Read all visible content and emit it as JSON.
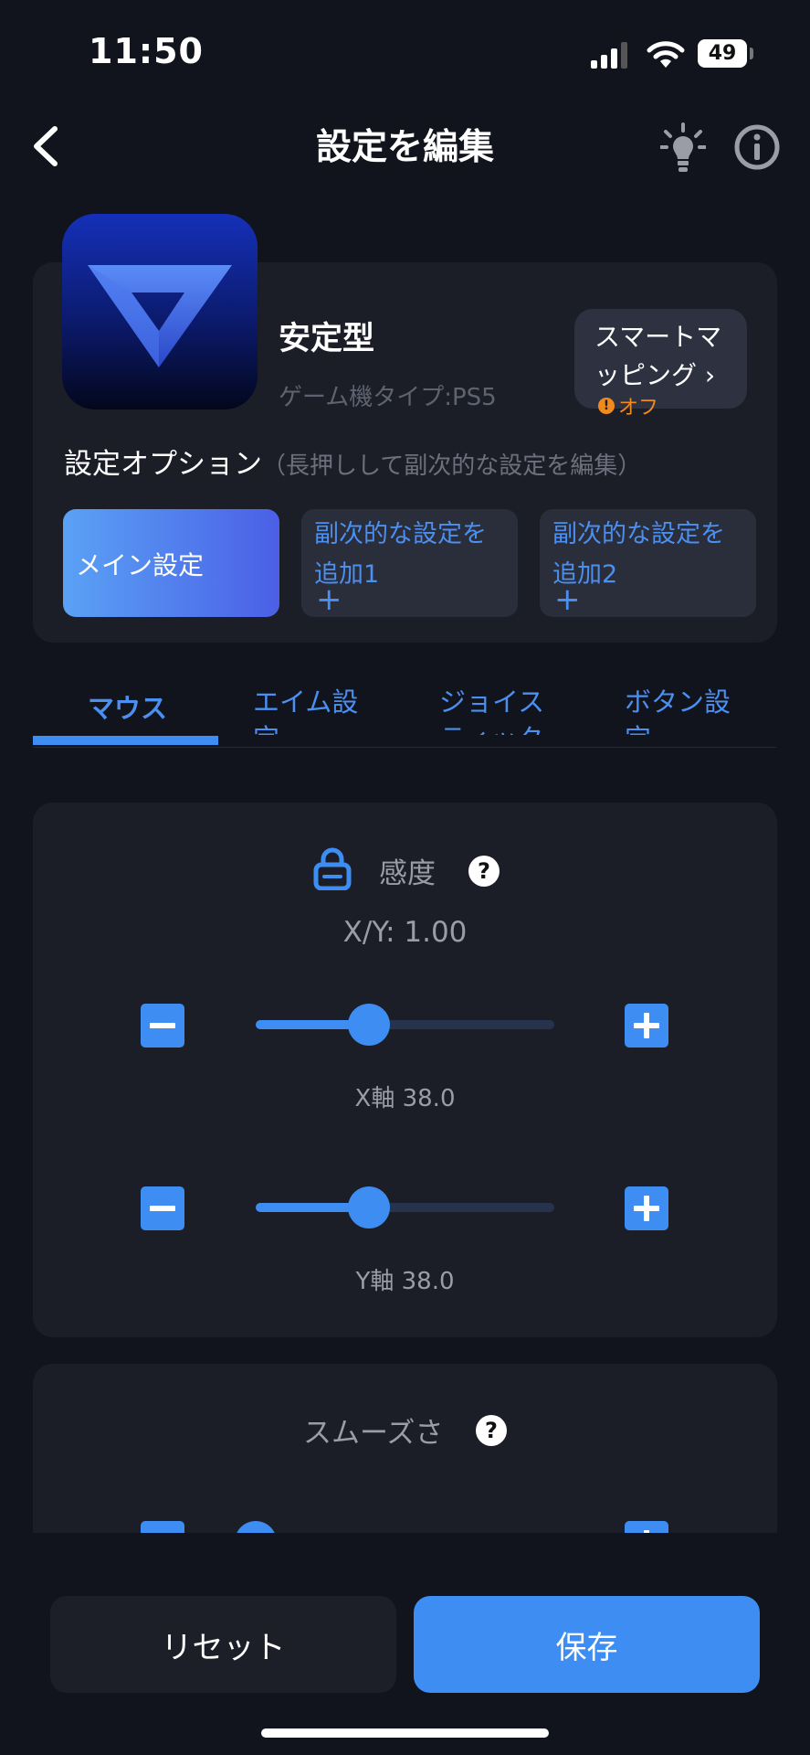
{
  "status_bar": {
    "time": "11:50",
    "battery": "49"
  },
  "header": {
    "title": "設定を編集"
  },
  "profile": {
    "name": "安定型",
    "console_type": "ゲーム機タイプ:PS5",
    "smart_mapping": {
      "label": "スマートマッピング ›",
      "status": "オフ",
      "status_icon": "!"
    }
  },
  "options": {
    "title": "設定オプション",
    "hint": "（長押しして副次的な設定を編集）",
    "main": "メイン設定",
    "sub1": "副次的な設定を追加1",
    "sub2": "副次的な設定を追加2",
    "add_symbol": "+"
  },
  "tabs": [
    {
      "label": "マウス",
      "active": true
    },
    {
      "label": "エイム設定"
    },
    {
      "label": "ジョイスティック"
    },
    {
      "label": "ボタン設定"
    }
  ],
  "sensitivity": {
    "title": "感度",
    "help": "?",
    "xy_label": "X/Y:  1.00",
    "x_axis": {
      "label": "X軸  38.0",
      "fraction": 0.38
    },
    "y_axis": {
      "label": "Y軸  38.0",
      "fraction": 0.38
    }
  },
  "smoothness": {
    "title": "スムーズさ",
    "help": "?"
  },
  "footer": {
    "reset": "リセット",
    "save": "保存"
  },
  "colors": {
    "accent": "#3d8df2",
    "warning": "#ef8a1d",
    "background": "#11141c",
    "card": "#1c1e27"
  }
}
